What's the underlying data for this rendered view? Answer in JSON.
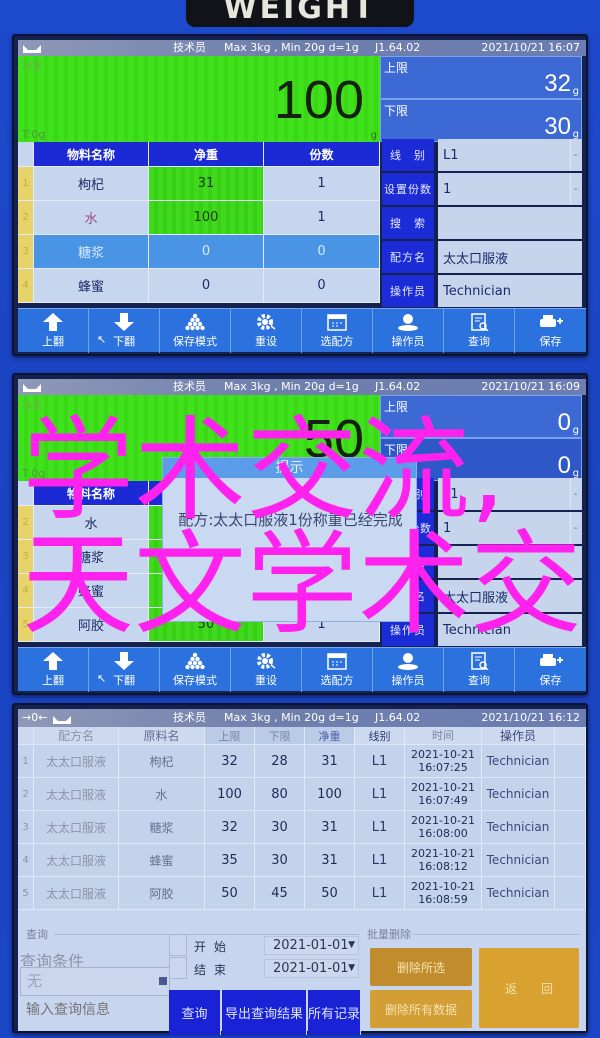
{
  "device_label": "WEIGHT",
  "toolbar": [
    {
      "label": "上翻",
      "icon": "arrow-up-icon"
    },
    {
      "label": "下翻",
      "icon": "arrow-down-icon"
    },
    {
      "label": "保存模式",
      "icon": "pyramid-icon"
    },
    {
      "label": "重设",
      "icon": "gear-icon"
    },
    {
      "label": "选配方",
      "icon": "calendar-icon"
    },
    {
      "label": "操作员",
      "icon": "operator-icon"
    },
    {
      "label": "查询",
      "icon": "document-search-icon"
    },
    {
      "label": "保存",
      "icon": "printer-plus-icon"
    }
  ],
  "weigh_screens": [
    {
      "status": {
        "role": "技术员",
        "spec": "Max 3kg , Min 20g  d=1g",
        "version": "J1.64.02",
        "datetime": "2021/10/21  16:07"
      },
      "weight": {
        "label": "净重",
        "value": "100",
        "unit": "g",
        "tare": "T:0g"
      },
      "limits": {
        "upper_label": "上限",
        "upper_value": "32",
        "lower_label": "下限",
        "lower_value": "30",
        "unit": "g"
      },
      "table": {
        "headers": [
          "物料名称",
          "净重",
          "份数"
        ],
        "rows": [
          {
            "index": "1",
            "name": "枸杞",
            "net": "31",
            "count": "1"
          },
          {
            "index": "2",
            "name": "水",
            "net": "100",
            "count": "1"
          },
          {
            "index": "3",
            "name": "糖浆",
            "net": "0",
            "count": "0",
            "selected": true
          },
          {
            "index": "4",
            "name": "蜂蜜",
            "net": "0",
            "count": "0"
          }
        ]
      },
      "fields": [
        {
          "label": "线　别",
          "value": "L1"
        },
        {
          "label": "设置份数",
          "value": "1"
        },
        {
          "label": "搜　索",
          "value": ""
        },
        {
          "label": "配方名",
          "value": "太太口服液"
        },
        {
          "label": "操作员",
          "value": "Technician"
        }
      ]
    },
    {
      "status": {
        "role": "技术员",
        "spec": "Max 3kg , Min 20g  d=1g",
        "version": "J1.64.02",
        "datetime": "2021/10/21  16:09"
      },
      "weight": {
        "label": "净重",
        "value": "50",
        "unit": "g",
        "tare": "T:0g"
      },
      "limits": {
        "upper_label": "上限",
        "upper_value": "0",
        "lower_label": "下限",
        "lower_value": "0",
        "unit": "g"
      },
      "table": {
        "headers": [
          "物料名称",
          "净重",
          "份数"
        ],
        "rows": [
          {
            "index": "2",
            "name": "水",
            "net": "",
            "count": ""
          },
          {
            "index": "3",
            "name": "糖浆",
            "net": "",
            "count": ""
          },
          {
            "index": "4",
            "name": "蜂蜜",
            "net": "",
            "count": ""
          },
          {
            "index": "5",
            "name": "阿胶",
            "net": "50",
            "count": "1"
          }
        ]
      },
      "fields": [
        {
          "label": "线　别",
          "value": "L1"
        },
        {
          "label": "设置份数",
          "value": "1"
        },
        {
          "label": "搜　索",
          "value": ""
        },
        {
          "label": "配方名",
          "value": "太太口服液"
        },
        {
          "label": "操作员",
          "value": "Technician"
        }
      ],
      "dialog": {
        "title": "提示",
        "message": "配方:太太口服液1份称重已经完成"
      }
    }
  ],
  "query_screen": {
    "status": {
      "zero_indicator": "→0←",
      "role": "技术员",
      "spec": "Max 3kg , Min 20g  d=1g",
      "version": "J1.64.02",
      "datetime": "2021/10/21  16:12"
    },
    "table": {
      "headers": [
        "配方名",
        "原料名",
        "上限",
        "下限",
        "净重",
        "线别",
        "时间",
        "操作员"
      ],
      "rows": [
        {
          "index": "1",
          "recipe": "太太口服液",
          "material": "枸杞",
          "upper": "32",
          "lower": "28",
          "net": "31",
          "line": "L1",
          "date": "2021-10-21",
          "time": "16:07:25",
          "operator": "Technician"
        },
        {
          "index": "2",
          "recipe": "太太口服液",
          "material": "水",
          "upper": "100",
          "lower": "80",
          "net": "100",
          "line": "L1",
          "date": "2021-10-21",
          "time": "16:07:49",
          "operator": "Technician"
        },
        {
          "index": "3",
          "recipe": "太太口服液",
          "material": "糖浆",
          "upper": "32",
          "lower": "30",
          "net": "31",
          "line": "L1",
          "date": "2021-10-21",
          "time": "16:08:00",
          "operator": "Technician"
        },
        {
          "index": "4",
          "recipe": "太太口服液",
          "material": "蜂蜜",
          "upper": "35",
          "lower": "30",
          "net": "31",
          "line": "L1",
          "date": "2021-10-21",
          "time": "16:08:12",
          "operator": "Technician"
        },
        {
          "index": "5",
          "recipe": "太太口服液",
          "material": "阿胶",
          "upper": "50",
          "lower": "45",
          "net": "50",
          "line": "L1",
          "date": "2021-10-21",
          "time": "16:08:59",
          "operator": "Technician"
        }
      ]
    },
    "query": {
      "legend": "查询",
      "condition_label": "查询条件",
      "condition_value": "无",
      "input_placeholder": "输入查询信息",
      "start_label": "开始",
      "start_date": "2021-01-01",
      "end_label": "结束",
      "end_date": "2021-01-01",
      "search_button": "查询",
      "export_button": "导出查询结果",
      "all_records_button": "所有记录"
    },
    "batch_delete": {
      "legend": "批量删除",
      "delete_selected": "删除所选",
      "delete_all": "删除所有数据",
      "back": "返　　回"
    }
  },
  "overlay": {
    "lines": [
      "学术交流,",
      "天文学术交"
    ],
    "color": "#ff22ee"
  }
}
